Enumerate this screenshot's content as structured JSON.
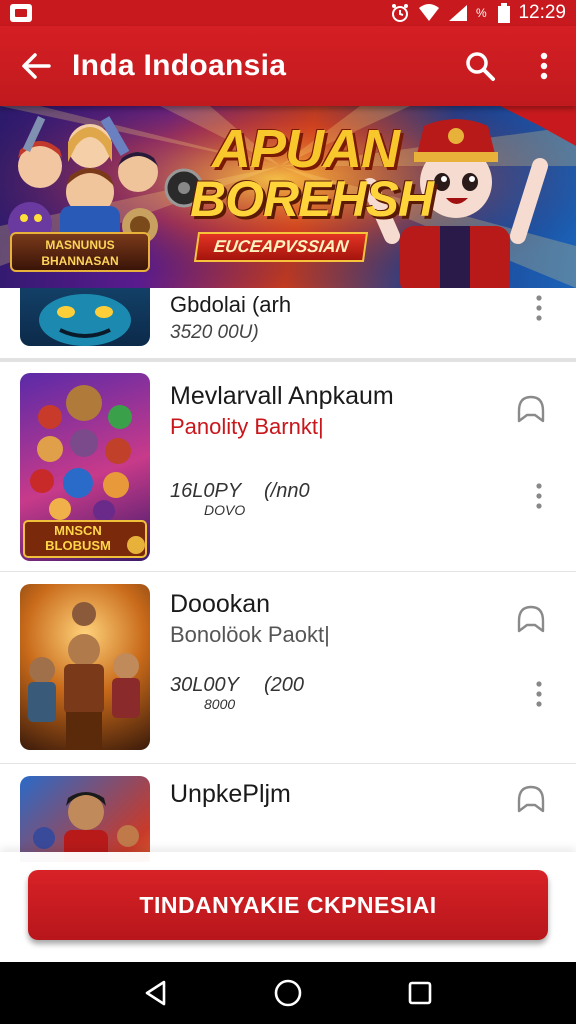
{
  "status_bar": {
    "time": "12:29"
  },
  "toolbar": {
    "title": "Inda Indoansia"
  },
  "banner": {
    "title_line1": "APUAN",
    "title_line2": "BOREHSH",
    "subtitle": "EUCEAPVSSIAN",
    "left_logo": "MASNUNUS BHANNASAN"
  },
  "items": [
    {
      "title": "Gbdolai  (arh",
      "subtitle": "",
      "meta_1": "",
      "meta_2": "",
      "meta_small": "",
      "extra": "3520 00U)"
    },
    {
      "title": "Mevlarvall Anpkaum",
      "subtitle": "Panolity Barnkt|",
      "meta_1": "16L0PY",
      "meta_2": "(/nn0",
      "meta_small": "DOVO"
    },
    {
      "title": "Doookan",
      "subtitle": "Bonolöok Paokt|",
      "meta_1": "30L00Y",
      "meta_2": "(200",
      "meta_small": "8000"
    },
    {
      "title": "UnpkePljm",
      "subtitle": "",
      "meta_1": "",
      "meta_2": "",
      "meta_small": ""
    }
  ],
  "thumb_labels": {
    "item2": "MNSCN BLOBUSM"
  },
  "action_button": {
    "label": "TINDANYAKIE CKPNESIAI"
  },
  "colors": {
    "primary": "#c81a1e",
    "accent": "#f7c72b",
    "text": "#1a1a1a"
  }
}
